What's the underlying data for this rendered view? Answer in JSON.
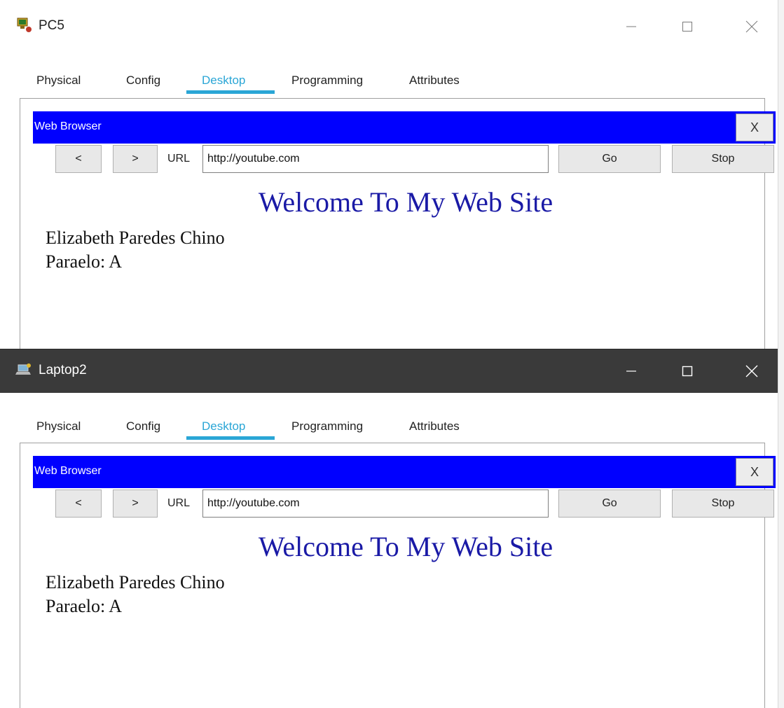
{
  "pc5": {
    "title": "PC5",
    "tabs": [
      {
        "label": "Physical"
      },
      {
        "label": "Config"
      },
      {
        "label": "Desktop"
      },
      {
        "label": "Programming"
      },
      {
        "label": "Attributes"
      }
    ],
    "active_tab": "Desktop",
    "browser": {
      "title": "Web Browser",
      "close_label": "X",
      "back_label": "<",
      "forward_label": ">",
      "url_label": "URL",
      "url_value": "http://youtube.com",
      "go_label": "Go",
      "stop_label": "Stop",
      "page": {
        "heading": "Welcome To My Web Site",
        "line1": "Elizabeth Paredes Chino",
        "line2": "Paraelo: A"
      }
    }
  },
  "laptop2": {
    "title": "Laptop2",
    "tabs": [
      {
        "label": "Physical"
      },
      {
        "label": "Config"
      },
      {
        "label": "Desktop"
      },
      {
        "label": "Programming"
      },
      {
        "label": "Attributes"
      }
    ],
    "active_tab": "Desktop",
    "browser": {
      "title": "Web Browser",
      "close_label": "X",
      "back_label": "<",
      "forward_label": ">",
      "url_label": "URL",
      "url_value": "http://youtube.com",
      "go_label": "Go",
      "stop_label": "Stop",
      "page": {
        "heading": "Welcome To My Web Site",
        "line1": "Elizabeth Paredes Chino",
        "line2": "Paraelo: A"
      }
    }
  },
  "colors": {
    "browser_titlebar": "#0000ff",
    "active_tab": "#2aa6d6",
    "heading_text": "#1a1aa6",
    "dark_titlebar": "#3a3a3a"
  },
  "icons": {
    "pc5": "pc-app-icon",
    "laptop2": "laptop-app-icon",
    "window_controls": [
      "minimize-icon",
      "maximize-icon",
      "close-icon"
    ]
  }
}
